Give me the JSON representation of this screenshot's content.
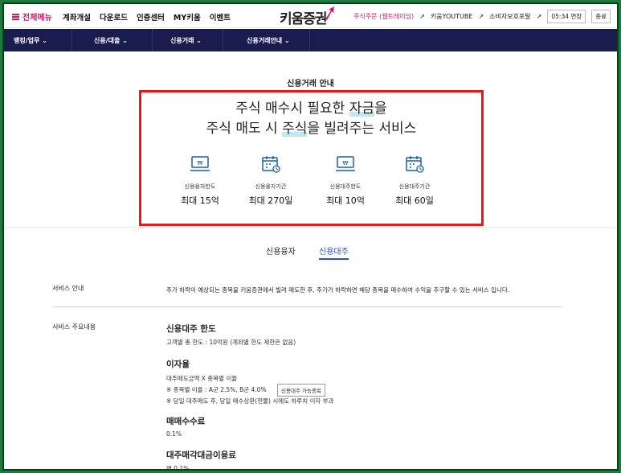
{
  "topbar": {
    "menu_all": "전체메뉴",
    "nav": [
      "계좌개설",
      "다운로드",
      "인증센터",
      "MY키움",
      "이벤트"
    ],
    "logo": "키움증권",
    "util_pink": "주식주문 (웹트레이딩)",
    "util_youtube": "키움YOUTUBE",
    "util_consumer": "소비자보호포탈",
    "util_timer": "05:34 연장",
    "util_logout": "종료"
  },
  "navbar": {
    "items": [
      "뱅킹/업무",
      "신용/대출",
      "신용거래",
      "신용거래안내"
    ]
  },
  "hero": {
    "label": "신용거래 안내",
    "headline_1_pre": "주식 매수시 필요한 ",
    "headline_1_mark": "자금",
    "headline_1_post": "을",
    "headline_2_pre": "주식 매도 시 ",
    "headline_2_mark": "주식",
    "headline_2_post": "을 빌려주는 서비스",
    "stats": [
      {
        "label": "신용융자한도",
        "value": "최대 15억",
        "icon": "money-icon"
      },
      {
        "label": "신용융자기간",
        "value": "최대 270일",
        "icon": "calendar-icon"
      },
      {
        "label": "신용대주한도",
        "value": "최대 10억",
        "icon": "money-icon"
      },
      {
        "label": "신용대주기간",
        "value": "최대 60일",
        "icon": "calendar-icon"
      }
    ]
  },
  "tabs": {
    "lend": "신용융자",
    "borrow": "신용대주"
  },
  "service_info": {
    "title": "서비스 안내",
    "text": "주가 하락이 예상되는 종목을 키움증권에서 빌려 매도한 후, 주가가 하락하면 해당 종목을 매수하여 수익을 추구할 수 있는 서비스 입니다."
  },
  "service_main": {
    "title": "서비스 주요내용",
    "limit_title": "신용대주 한도",
    "limit_text": "고객별 총 한도 : 10억원 (계좌별 한도 제한은 없음)",
    "rate_title": "이자율",
    "rate_text_1": "대주매도금액 X 종목별 이율",
    "rate_text_2": "※ 종목별 이율 : A군 2.5%, B군 4.0%",
    "rate_button": "신용대주 가능종목",
    "rate_text_3": "※ 당일 대주매도 후, 당일 매수상환(현물) 시에도 하루치 이자 부과",
    "fee_title": "매매수수료",
    "fee_text": "0.1%",
    "lending_title": "대주매각대금이용료",
    "lending_text": "연 0.1%"
  },
  "colors": {
    "accent": "#d0176b",
    "navbar": "#1a1c4e",
    "highlight": "#e41a1a",
    "tab_active": "#2a4fbf",
    "icon_blue": "#1f5fa8"
  }
}
